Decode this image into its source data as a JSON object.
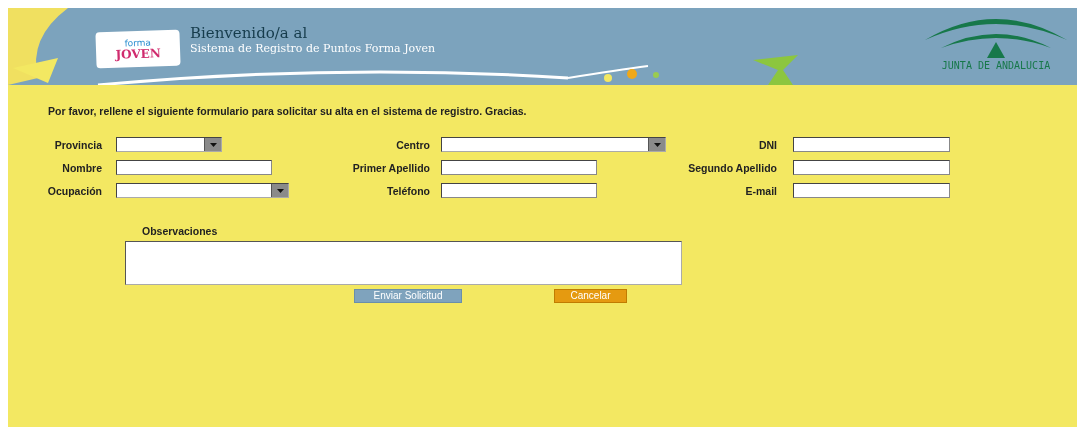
{
  "header": {
    "logo": {
      "line_1": "forma",
      "line_2": "JOVEN"
    },
    "title": "Bienvenido/a al",
    "subtitle": "Sistema de Registro de Puntos Forma Joven",
    "org_logo": "JUNTA DE ANDALUCIA"
  },
  "intro": "Por favor, rellene el siguiente formulario para solicitar su alta en el sistema de registro. Gracias.",
  "fields": [
    {
      "label": "Provincia",
      "kind": "select"
    },
    {
      "label": "Centro",
      "kind": "select"
    },
    {
      "label": "DNI",
      "kind": "text"
    },
    {
      "label": "Nombre",
      "kind": "text"
    },
    {
      "label": "Primer Apellido",
      "kind": "text"
    },
    {
      "label": "Segundo Apellido",
      "kind": "text"
    },
    {
      "label": "Ocupación",
      "kind": "select"
    },
    {
      "label": "Teléfono",
      "kind": "text"
    },
    {
      "label": "E-mail",
      "kind": "text"
    }
  ],
  "observations": {
    "label": "Observaciones"
  },
  "buttons": [
    {
      "label": "Enviar Solicitud",
      "kind": "primary"
    },
    {
      "label": "Cancelar",
      "kind": "cancel"
    }
  ]
}
